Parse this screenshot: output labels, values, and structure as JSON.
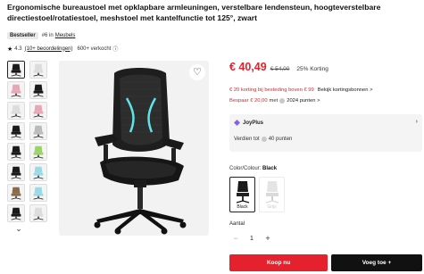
{
  "product": {
    "title": "Ergonomische bureaustoel met opklapbare armleuningen, verstelbare lendensteun, hoogteverstelbare directiestoel/rotatiestoel, meshstoel met kantelfunctie tot 125°, zwart",
    "badge": "Bestseller",
    "rank_text": "#6 in",
    "rank_category": "Meubels",
    "rating": "4.3",
    "reviews": "(10+ beoordelingen)",
    "sold": "600+ verkocht",
    "sold_icon": "info-icon"
  },
  "gallery": {
    "thumbnail_count": 16,
    "more_chevron": "⌄"
  },
  "pricing": {
    "price": "€ 40,49",
    "old_price": "€ 54,00",
    "discount": "25% Korting",
    "promo": "€ 20 korting bij besteding boven € 99",
    "promo_link": "Bekijk kortingsbonnen >",
    "save": "Bespaar € 20,00",
    "save_rest": "met",
    "save_points": "2024 punten >"
  },
  "joyplus": {
    "title": "JoyPlus",
    "text_before": "Verdien tot",
    "text_after": "40 punten",
    "chevron": "›"
  },
  "color": {
    "label": "Color/Colour:",
    "selected": "Black",
    "options": [
      {
        "name": "Black",
        "state": "selected"
      },
      {
        "name": "Grijs",
        "state": "unavailable"
      }
    ]
  },
  "quantity": {
    "label": "Aantal",
    "value": "1",
    "minus": "−",
    "plus": "+"
  },
  "buttons": {
    "buy": "Koop nu",
    "cart": "Voeg toe +"
  },
  "colors": {
    "accent": "#e4212c",
    "dark": "#111111"
  }
}
